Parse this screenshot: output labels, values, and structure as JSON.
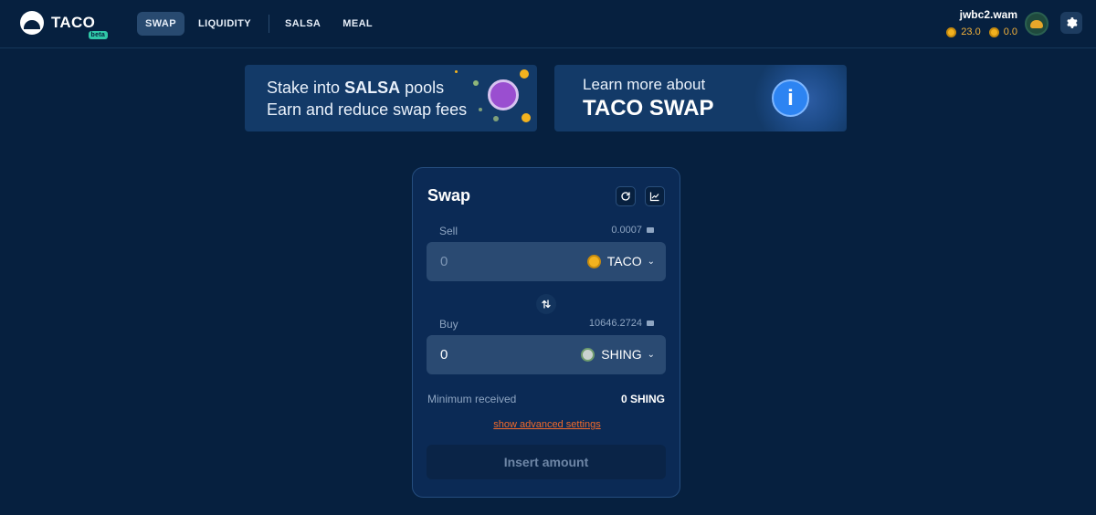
{
  "header": {
    "logo_text": "TACO",
    "beta_label": "beta",
    "nav": [
      {
        "label": "SWAP",
        "active": true
      },
      {
        "label": "LIQUIDITY",
        "active": false
      },
      {
        "label": "SALSA",
        "active": false
      },
      {
        "label": "MEAL",
        "active": false
      }
    ],
    "account": "jwbc2.wam",
    "balances": [
      {
        "icon": "taco-coin-icon",
        "value": "23.0"
      },
      {
        "icon": "salsa-coin-icon",
        "value": "0.0"
      }
    ]
  },
  "banners": {
    "salsa": {
      "prefix": "Stake into ",
      "highlight": "SALSA",
      "suffix": " pools",
      "line2": "Earn and reduce swap fees"
    },
    "info": {
      "line1": "Learn more about",
      "line2": "TACO SWAP",
      "icon_text": "i"
    }
  },
  "swap": {
    "title": "Swap",
    "sell": {
      "label": "Sell",
      "balance": "0.0007",
      "amount": "0",
      "token": "TACO"
    },
    "buy": {
      "label": "Buy",
      "balance": "10646.2724",
      "amount": "0",
      "token": "SHING"
    },
    "min_received_label": "Minimum received",
    "min_received_value": "0 SHING",
    "advanced_link": "show advanced settings",
    "submit_label": "Insert amount"
  },
  "colors": {
    "background": "#06203f",
    "card": "#0b2a55",
    "accent_orange": "#f26a2a",
    "coin_gold": "#f2b21f"
  }
}
